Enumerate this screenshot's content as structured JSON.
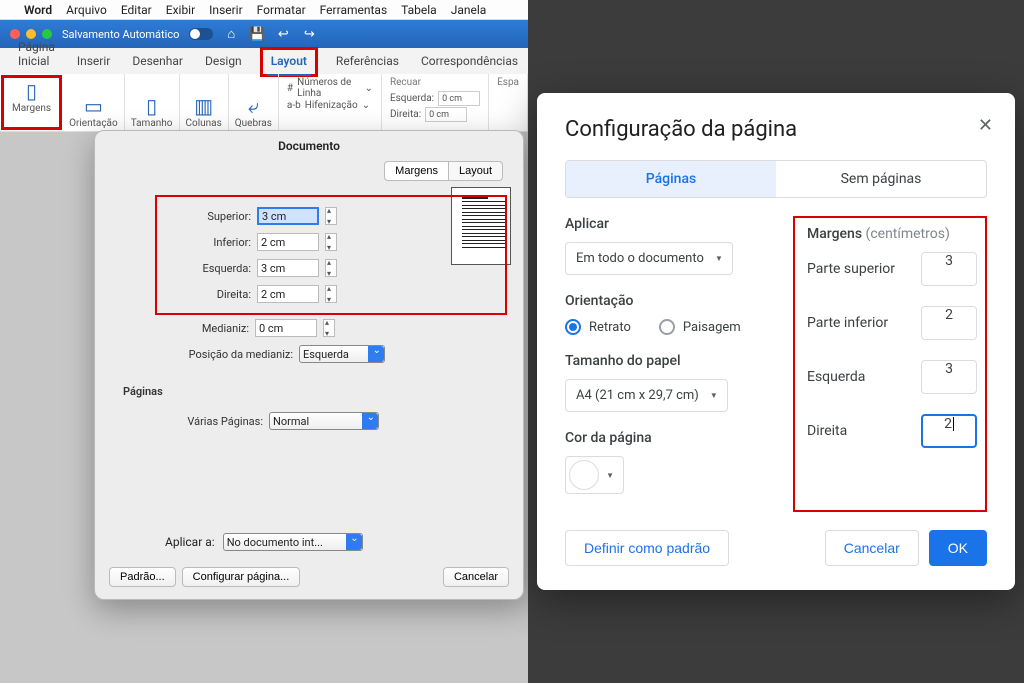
{
  "mac_menu": {
    "app": "Word",
    "items": [
      "Arquivo",
      "Editar",
      "Exibir",
      "Inserir",
      "Formatar",
      "Ferramentas",
      "Tabela",
      "Janela"
    ]
  },
  "word_title": {
    "autosave": "Salvamento Automático"
  },
  "word_tabs": {
    "home": "Página Inicial",
    "insert": "Inserir",
    "draw": "Desenhar",
    "design": "Design",
    "layout": "Layout",
    "references": "Referências",
    "mailings": "Correspondências"
  },
  "ribbon": {
    "margins": "Margens",
    "orientation": "Orientação",
    "size": "Tamanho",
    "columns": "Colunas",
    "breaks": "Quebras",
    "lineno": "Números de Linha",
    "hyphen": "Hifenização",
    "indent_hdr": "Recuar",
    "indent_left_lbl": "Esquerda:",
    "indent_right_lbl": "Direita:",
    "indent_left": "0 cm",
    "indent_right": "0 cm",
    "space_hdr": "Espa"
  },
  "dlg": {
    "title": "Documento",
    "tab_margins": "Margens",
    "tab_layout": "Layout",
    "top_lbl": "Superior:",
    "top": "3 cm",
    "bottom_lbl": "Inferior:",
    "bottom": "2 cm",
    "left_lbl": "Esquerda:",
    "left": "3 cm",
    "right_lbl": "Direita:",
    "right": "2 cm",
    "gutter_lbl": "Medianiz:",
    "gutter": "0 cm",
    "gutterpos_lbl": "Posição da medianiz:",
    "gutterpos": "Esquerda",
    "pages_hdr": "Páginas",
    "multipage_lbl": "Várias Páginas:",
    "multipage": "Normal",
    "apply_lbl": "Aplicar a:",
    "apply": "No documento int...",
    "default": "Padrão...",
    "pagesetup": "Configurar página...",
    "cancel": "Cancelar"
  },
  "gdocs": {
    "title": "Configuração da página",
    "tab_pages": "Páginas",
    "tab_pageless": "Sem páginas",
    "apply_lbl": "Aplicar",
    "apply": "Em todo o documento",
    "orient_lbl": "Orientação",
    "portrait": "Retrato",
    "landscape": "Paisagem",
    "paper_lbl": "Tamanho do papel",
    "paper": "A4 (21 cm x 29,7 cm)",
    "color_lbl": "Cor da página",
    "margins_lbl": "Margens",
    "margins_unit": "(centímetros)",
    "top_lbl": "Parte superior",
    "top": "3",
    "bottom_lbl": "Parte inferior",
    "bottom": "2",
    "left_lbl": "Esquerda",
    "left": "3",
    "right_lbl": "Direita",
    "right": "2",
    "setdefault": "Definir como padrão",
    "cancel": "Cancelar",
    "ok": "OK"
  }
}
